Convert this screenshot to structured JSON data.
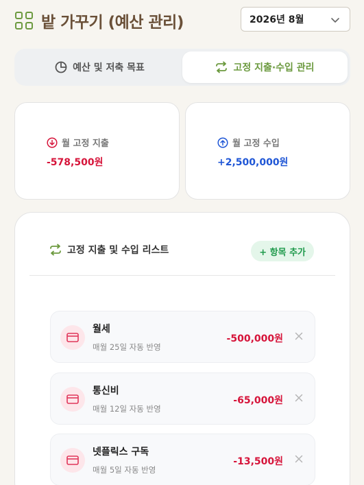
{
  "header": {
    "title": "밭 가꾸기 (예산 관리)",
    "month": "2026년 8월"
  },
  "tabs": [
    {
      "label": "예산 및 저축 목표",
      "active": false
    },
    {
      "label": "고정 지출·수입 관리",
      "active": true
    }
  ],
  "summary": {
    "expense_label": "월 고정 지출",
    "expense_value": "-578,500원",
    "income_label": "월 고정 수입",
    "income_value": "+2,500,000원"
  },
  "list": {
    "title": "고정 지출 및 수입 리스트",
    "add_label": "+ 항목 추가",
    "items": [
      {
        "name": "월세",
        "sub": "매월 25일 자동 반영",
        "amount": "-500,000원"
      },
      {
        "name": "통신비",
        "sub": "매월 12일 자동 반영",
        "amount": "-65,000원"
      },
      {
        "name": "넷플릭스 구독",
        "sub": "매월 5일 자동 반영",
        "amount": "-13,500원"
      }
    ]
  },
  "colors": {
    "accent": "#6c9a3f",
    "title": "#6a5038",
    "expense": "#d6143a",
    "income": "#1f56d6",
    "add": "#1f9a4c"
  }
}
